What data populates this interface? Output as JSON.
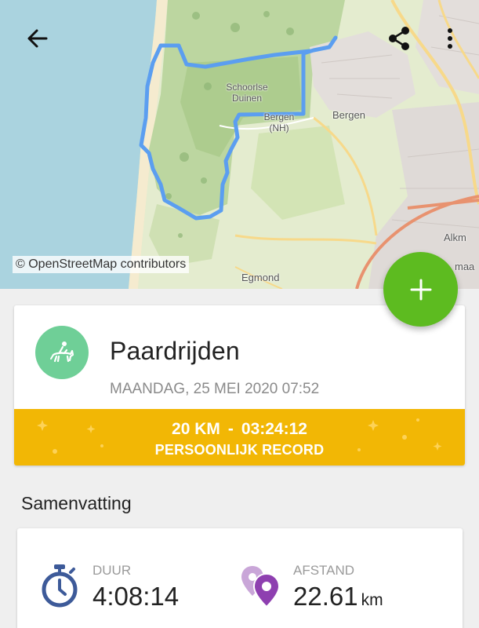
{
  "map": {
    "attribution": "© OpenStreetMap contributors",
    "labels": {
      "schoorlse_duinen": "Schoorlse\nDuinen",
      "bergen_nh": "Bergen\n(NH)",
      "bergen": "Bergen",
      "egmond": "Egmond",
      "alkmaar": "Alkm",
      "alkmaar2": "maa"
    },
    "route_color": "#5b9ef0"
  },
  "toolbar": {
    "back_icon": "arrow-left-icon",
    "share_icon": "share-icon",
    "more_icon": "more-vertical-icon"
  },
  "fab": {
    "icon": "plus-icon",
    "color": "#5dbb20"
  },
  "activity": {
    "sport_icon": "horse-riding-icon",
    "title": "Paardrijden",
    "date": "MAANDAG, 25 MEI 2020 07:52",
    "record": {
      "distance": "20 KM",
      "separator": "-",
      "time": "03:24:12",
      "label": "PERSOONLIJK RECORD",
      "color": "#f2b705"
    }
  },
  "summary": {
    "heading": "Samenvatting",
    "duration": {
      "icon": "stopwatch-icon",
      "label": "DUUR",
      "value": "4:08:14"
    },
    "distance": {
      "icon": "location-pins-icon",
      "label": "AFSTAND",
      "value": "22.61",
      "unit": "km"
    }
  }
}
